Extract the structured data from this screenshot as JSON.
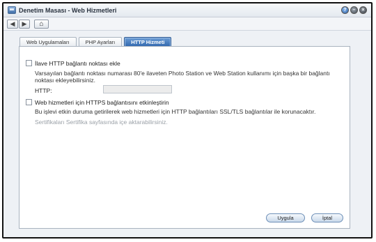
{
  "window": {
    "title": "Denetim Masası - Web Hizmetleri",
    "controls": {
      "help": "?",
      "minimize": "–",
      "close": "×"
    }
  },
  "navbar": {
    "back": "◀",
    "forward": "▶",
    "home": "⌂"
  },
  "tabs": [
    {
      "label": "Web Uygulamaları",
      "active": false
    },
    {
      "label": "PHP Ayarları",
      "active": false
    },
    {
      "label": "HTTP Hizmeti",
      "active": true
    }
  ],
  "http": {
    "extra_port_label": "İlave HTTP bağlantı noktası ekle",
    "extra_port_desc_1": "Varsayılan bağlantı noktası numarası 80'e ilaveten Photo Station ve Web Station kullanımı için başka bir bağlantı",
    "extra_port_desc_2": "noktası ekleyebilirsiniz.",
    "http_field_label": "HTTP:",
    "http_field_value": "",
    "https_label": "Web hizmetleri için HTTPS bağlantısını etkinleştirin",
    "https_desc": "Bu işlevi etkin duruma getirilerek web hizmetleri için HTTP bağlantıları SSL/TLS bağlantılar ile korunacaktır.",
    "cert_note": "Sertifikaları Sertifika sayfasında içe aktarabilirsiniz."
  },
  "footer": {
    "apply_label": "Uygula",
    "cancel_label": "İptal"
  }
}
